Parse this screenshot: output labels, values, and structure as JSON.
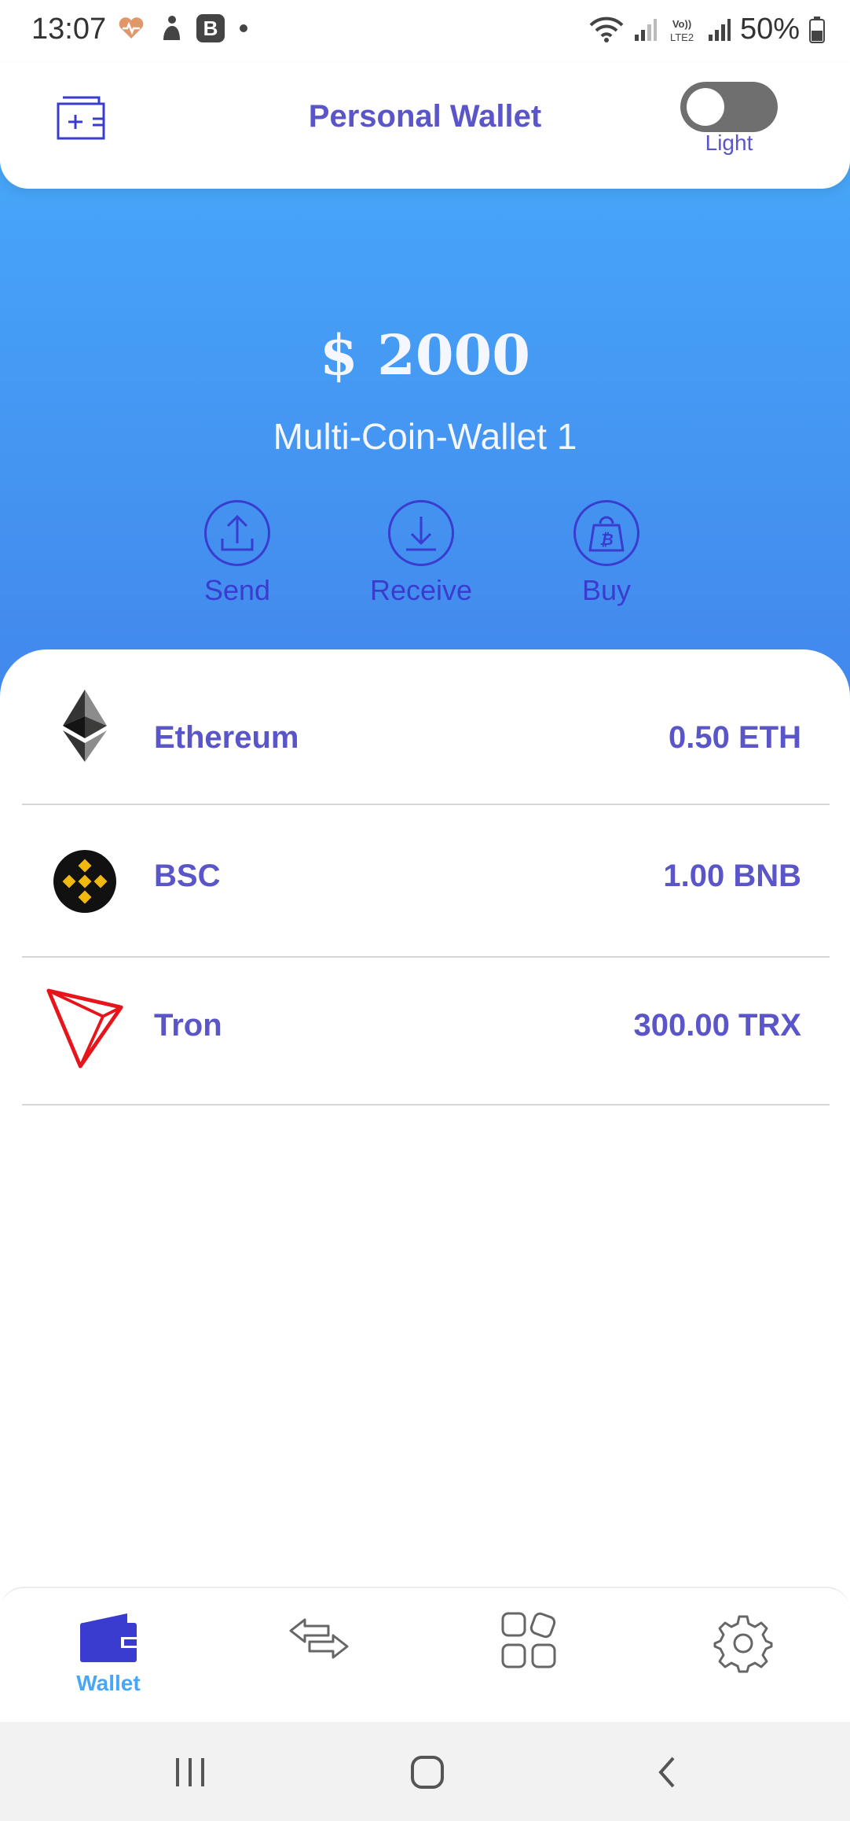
{
  "status_bar": {
    "time": "13:07",
    "battery": "50%",
    "icons": [
      "health-icon",
      "notification-icon",
      "b-app-icon",
      "dot-icon",
      "wifi-icon",
      "signal-icon",
      "volte-icon",
      "signal-icon",
      "battery-icon"
    ]
  },
  "header": {
    "title": "Personal Wallet",
    "toggle_label": "Light",
    "toggle_on": false
  },
  "hero": {
    "balance": "$ 2000",
    "wallet_name": "Multi-Coin-Wallet 1",
    "actions": [
      {
        "label": "Send",
        "icon": "upload-icon"
      },
      {
        "label": "Receive",
        "icon": "download-icon"
      },
      {
        "label": "Buy",
        "icon": "bitcoin-bag-icon"
      }
    ]
  },
  "coins": [
    {
      "name": "Ethereum",
      "amount": "0.50 ETH",
      "icon": "ethereum-icon"
    },
    {
      "name": "BSC",
      "amount": "1.00 BNB",
      "icon": "bnb-icon"
    },
    {
      "name": "Tron",
      "amount": "300.00 TRX",
      "icon": "tron-icon"
    }
  ],
  "bottom_nav": {
    "items": [
      {
        "label": "Wallet",
        "icon": "wallet-icon",
        "active": true
      },
      {
        "label": "",
        "icon": "swap-icon",
        "active": false
      },
      {
        "label": "",
        "icon": "apps-icon",
        "active": false
      },
      {
        "label": "",
        "icon": "settings-icon",
        "active": false
      }
    ]
  },
  "colors": {
    "accent": "#5a55c9",
    "action": "#3a3ccf",
    "hero_top": "#47a6f8",
    "hero_bottom": "#4287ec",
    "nav_active": "#47a6f8",
    "tron_red": "#e8141b",
    "bnb_yellow": "#f0b90b"
  }
}
